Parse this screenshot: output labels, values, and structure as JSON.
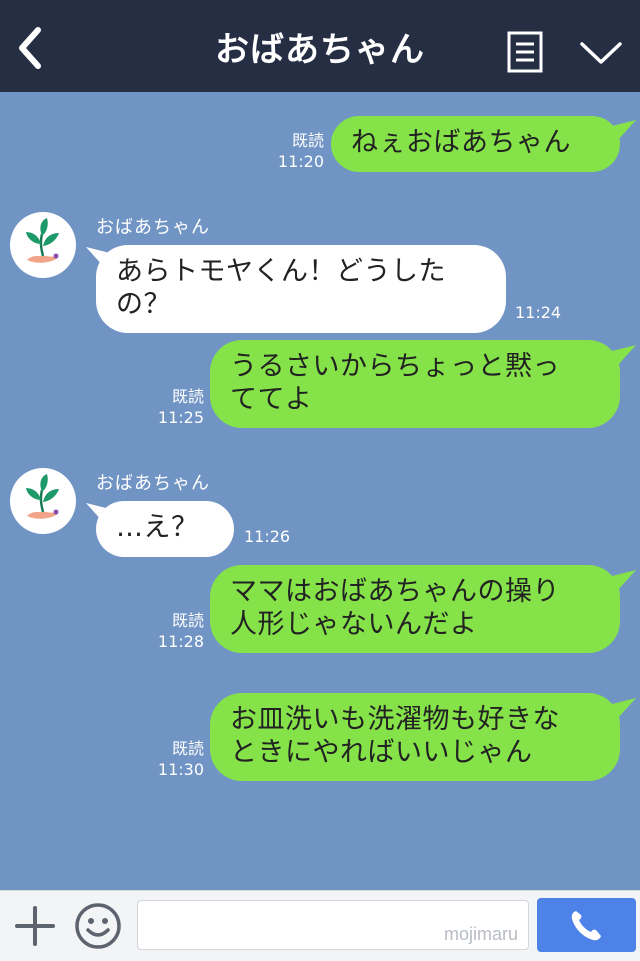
{
  "header": {
    "title": "おばあちゃん",
    "back_icon": "chevron-left-icon",
    "menu_icon": "list-icon",
    "expand_icon": "chevron-down-icon"
  },
  "messages": [
    {
      "side": "right",
      "read": "既読",
      "time": "11:20",
      "lines": [
        "ねぇおばあちゃん"
      ]
    },
    {
      "side": "left",
      "sender": "おばあちゃん",
      "time": "11:24",
      "lines": [
        "あらトモヤくん！どうした",
        "の？"
      ]
    },
    {
      "side": "right",
      "read": "既読",
      "time": "11:25",
      "lines": [
        "うるさいからちょっと黙っ",
        "ててよ"
      ]
    },
    {
      "side": "left",
      "sender": "おばあちゃん",
      "time": "11:26",
      "lines": [
        "…え？"
      ]
    },
    {
      "side": "right",
      "read": "既読",
      "time": "11:28",
      "lines": [
        "ママはおばあちゃんの操り",
        "人形じゃないんだよ"
      ]
    },
    {
      "side": "right",
      "read": "既読",
      "time": "11:30",
      "lines": [
        "お皿洗いも洗濯物も好きな",
        "ときにやればいいじゃん"
      ]
    }
  ],
  "input": {
    "placeholder": "",
    "watermark": "mojimaru"
  },
  "colors": {
    "header_bg": "#252e43",
    "chat_bg": "#7094c4",
    "bubble_self": "#85e249",
    "bubble_other": "#ffffff",
    "call_button": "#4d82e8"
  }
}
